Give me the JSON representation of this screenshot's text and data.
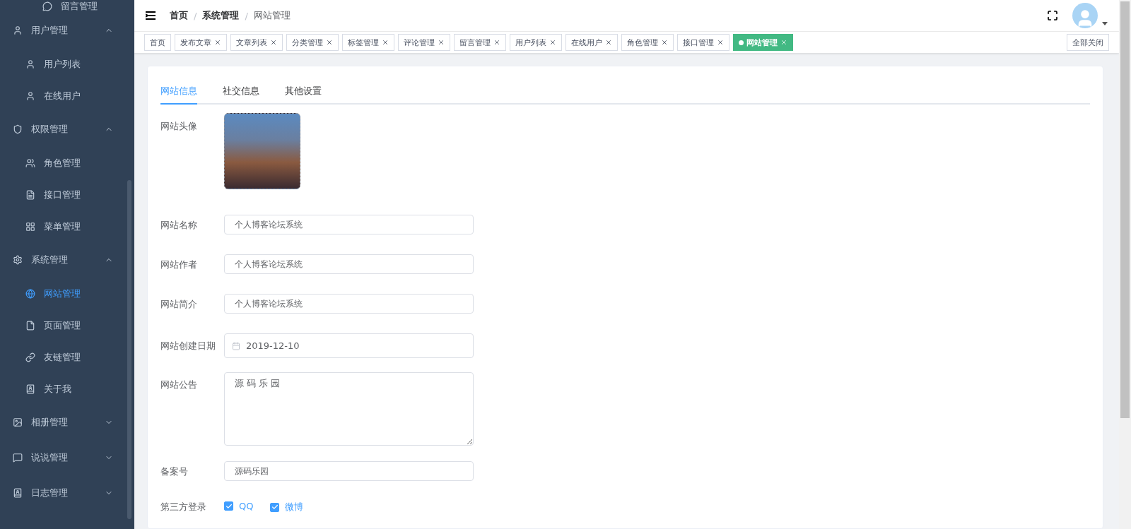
{
  "sidebar": {
    "items": [
      {
        "label": "留言管理",
        "selected": false
      },
      {
        "label": "用户管理",
        "expanded": true,
        "children": [
          {
            "label": "用户列表",
            "selected": false
          },
          {
            "label": "在线用户",
            "selected": false
          }
        ]
      },
      {
        "label": "权限管理",
        "expanded": true,
        "children": [
          {
            "label": "角色管理",
            "selected": false
          },
          {
            "label": "接口管理",
            "selected": false
          },
          {
            "label": "菜单管理",
            "selected": false
          }
        ]
      },
      {
        "label": "系统管理",
        "expanded": true,
        "children": [
          {
            "label": "网站管理",
            "selected": true
          },
          {
            "label": "页面管理",
            "selected": false
          },
          {
            "label": "友链管理",
            "selected": false
          },
          {
            "label": "关于我",
            "selected": false
          }
        ]
      },
      {
        "label": "相册管理",
        "expanded": false
      },
      {
        "label": "说说管理",
        "expanded": false
      },
      {
        "label": "日志管理",
        "expanded": false
      }
    ]
  },
  "breadcrumb": {
    "separator": "/",
    "items": [
      {
        "label": "首页",
        "current": false
      },
      {
        "label": "系统管理",
        "current": false
      },
      {
        "label": "网站管理",
        "current": true
      }
    ]
  },
  "tags": [
    {
      "label": "首页",
      "closable": false,
      "selected": false
    },
    {
      "label": "发布文章",
      "closable": true,
      "selected": false
    },
    {
      "label": "文章列表",
      "closable": true,
      "selected": false
    },
    {
      "label": "分类管理",
      "closable": true,
      "selected": false
    },
    {
      "label": "标签管理",
      "closable": true,
      "selected": false
    },
    {
      "label": "评论管理",
      "closable": true,
      "selected": false
    },
    {
      "label": "留言管理",
      "closable": true,
      "selected": false
    },
    {
      "label": "用户列表",
      "closable": true,
      "selected": false
    },
    {
      "label": "在线用户",
      "closable": true,
      "selected": false
    },
    {
      "label": "角色管理",
      "closable": true,
      "selected": false
    },
    {
      "label": "接口管理",
      "closable": true,
      "selected": false
    },
    {
      "label": "网站管理",
      "closable": true,
      "selected": true
    }
  ],
  "close_all": "全部关闭",
  "tabs": [
    {
      "label": "网站信息",
      "selected": true
    },
    {
      "label": "社交信息",
      "selected": false
    },
    {
      "label": "其他设置",
      "selected": false
    }
  ],
  "form": [
    {
      "kind": "image",
      "label": "网站头像"
    },
    {
      "kind": "input",
      "label": "网站名称",
      "value": "个人博客论坛系统"
    },
    {
      "kind": "input",
      "label": "网站作者",
      "value": "个人博客论坛系统"
    },
    {
      "kind": "input",
      "label": "网站简介",
      "value": "个人博客论坛系统"
    },
    {
      "kind": "date",
      "label": "网站创建日期",
      "value": "2019-12-10"
    },
    {
      "kind": "textarea",
      "label": "网站公告",
      "value": "源 码 乐 园"
    },
    {
      "kind": "input",
      "label": "备案号",
      "value": "源码乐园"
    },
    {
      "kind": "checkboxes",
      "label": "第三方登录",
      "options": [
        {
          "label": "QQ",
          "checked": true
        },
        {
          "label": "微博",
          "checked": true
        }
      ]
    }
  ]
}
